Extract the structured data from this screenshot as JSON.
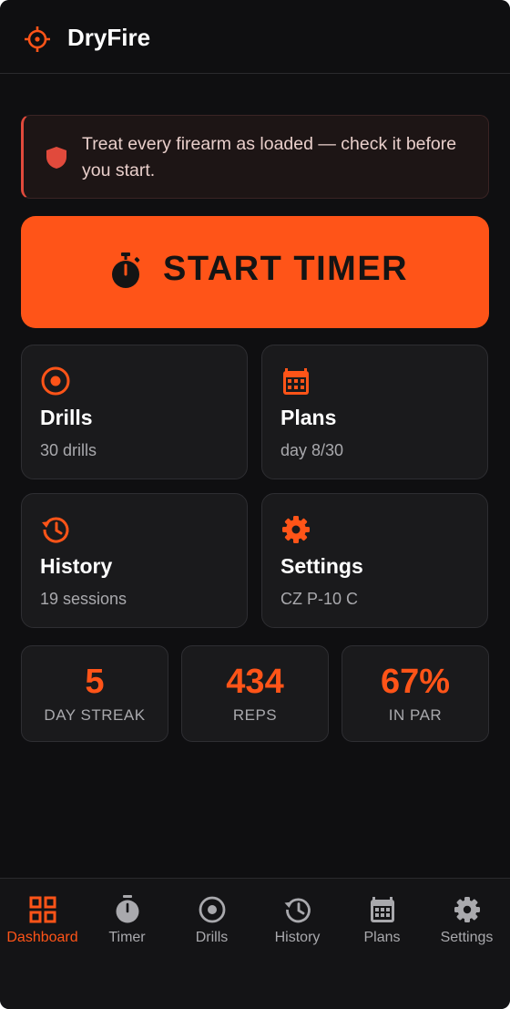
{
  "app": {
    "title": "DryFire"
  },
  "alert": {
    "message": "Treat every firearm as loaded — check it before you start."
  },
  "start_button": {
    "label": "START TIMER"
  },
  "cards": [
    {
      "title": "Drills",
      "subtitle": "30 drills",
      "icon": "target-icon"
    },
    {
      "title": "Plans",
      "subtitle": "day 8/30",
      "icon": "calendar-icon"
    },
    {
      "title": "History",
      "subtitle": "19 sessions",
      "icon": "history-icon"
    },
    {
      "title": "Settings",
      "subtitle": "CZ P-10 C",
      "icon": "gear-icon"
    }
  ],
  "stats": [
    {
      "value": "5",
      "label": "DAY STREAK"
    },
    {
      "value": "434",
      "label": "REPS"
    },
    {
      "value": "67%",
      "label": "IN PAR"
    }
  ],
  "nav": [
    {
      "label": "Dashboard",
      "icon": "grid-icon",
      "active": true
    },
    {
      "label": "Timer",
      "icon": "stopwatch-icon",
      "active": false
    },
    {
      "label": "Drills",
      "icon": "target-icon",
      "active": false
    },
    {
      "label": "History",
      "icon": "history-icon",
      "active": false
    },
    {
      "label": "Plans",
      "icon": "calendar-icon",
      "active": false
    },
    {
      "label": "Settings",
      "icon": "gear-icon",
      "active": false
    }
  ],
  "colors": {
    "accent": "#ff5418",
    "background": "#0f0f11",
    "card": "#1a1a1c",
    "alert_accent": "#e14a3c",
    "muted_text": "#a9a9ad"
  }
}
